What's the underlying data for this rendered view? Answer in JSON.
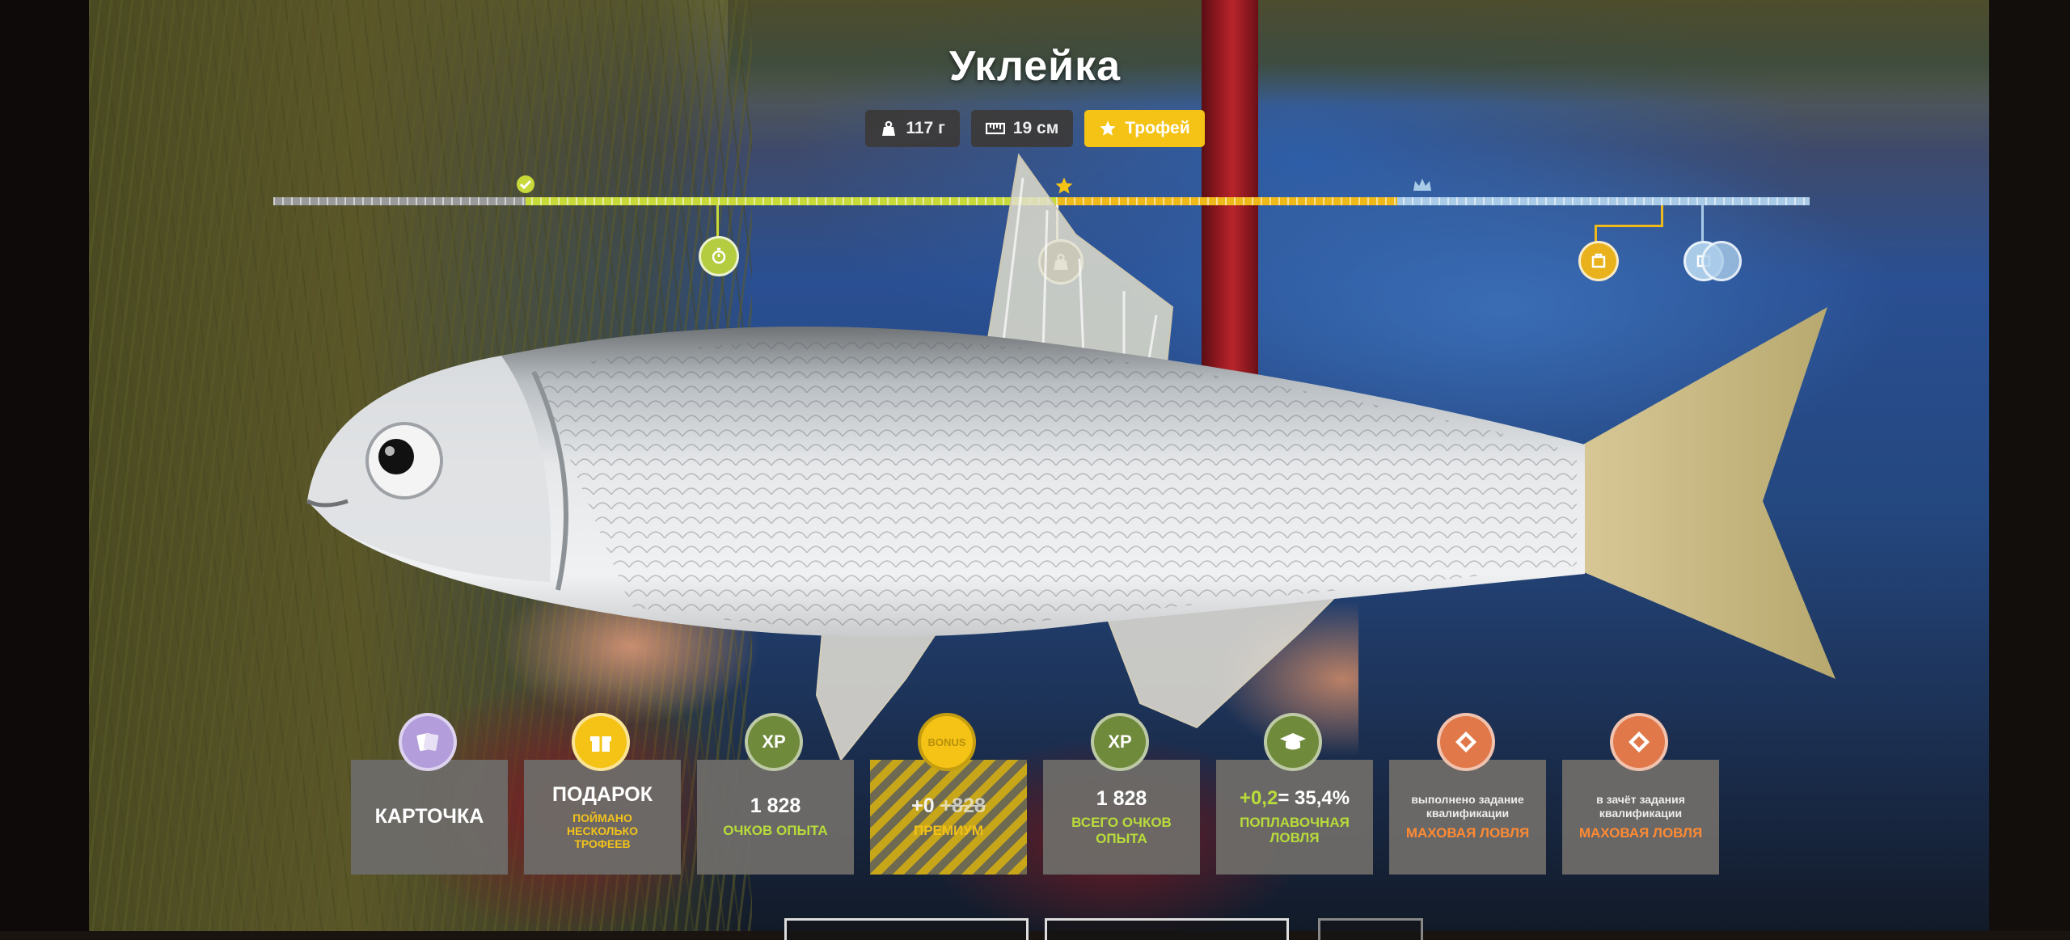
{
  "fish": {
    "name": "Уклейка",
    "weight": "117 г",
    "length": "19 см",
    "trophy_label": "Трофей",
    "weight_icon": "weight-icon",
    "length_icon": "ruler-icon",
    "trophy_icon": "star-icon"
  },
  "ruler": {
    "top_icons": [
      "check-icon",
      "star-icon",
      "crown-icon"
    ],
    "markers": [
      "stopwatch-icon",
      "weight-icon",
      "trophy-box-icon",
      "record-icon"
    ],
    "colors": {
      "green": "#b8dc3a",
      "yellow": "#f4c315",
      "blue": "#a9cbe8",
      "gray": "#9a9a9a"
    }
  },
  "rewards": [
    {
      "id": "card",
      "title": "КАРТОЧКА",
      "sub": "",
      "icon": "cards-icon",
      "badge_color": "#b39ddb"
    },
    {
      "id": "gift",
      "title": "ПОДАРОК",
      "sub": "ПОЙМАНО НЕСКОЛЬКО ТРОФЕЕВ",
      "icon": "gift-icon",
      "badge_color": "#f4c315"
    },
    {
      "id": "xp",
      "title": "1 828",
      "sub": "ОЧКОВ ОПЫТА",
      "icon": "xp-icon",
      "icon_text": "XP",
      "badge_color": "#6f8a3a"
    },
    {
      "id": "premium",
      "title_a": "+0",
      "title_b": "+828",
      "sub": "ПРЕМИУМ",
      "icon": "bonus-icon",
      "badge_color": "#f4c315",
      "badge_text": "BONUS"
    },
    {
      "id": "xp-total",
      "title": "1 828",
      "sub": "ВСЕГО ОЧКОВ ОПЫТА",
      "icon": "xp-icon",
      "icon_text": "XP",
      "badge_color": "#6f8a3a"
    },
    {
      "id": "skill",
      "title_a": "+0,2",
      "title_b": "= 35,4%",
      "sub": "ПОПЛАВОЧНАЯ ЛОВЛЯ",
      "icon": "graduation-cap-icon",
      "badge_color": "#6f8a3a"
    },
    {
      "id": "qual-done",
      "note": "выполнено задание квалификации",
      "sub": "МАХОВАЯ ЛОВЛЯ",
      "icon": "diamond-icon",
      "badge_color": "#e0784a"
    },
    {
      "id": "qual-count",
      "note": "в зачёт задания квалификации",
      "sub": "МАХОВАЯ ЛОВЛЯ",
      "icon": "diamond-icon",
      "badge_color": "#e0784a"
    }
  ]
}
